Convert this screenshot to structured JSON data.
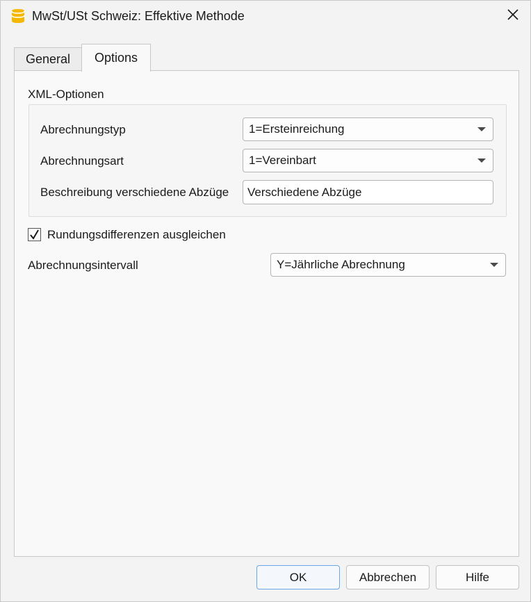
{
  "window": {
    "title": "MwSt/USt Schweiz: Effektive Methode"
  },
  "tabs": [
    {
      "label": "General",
      "active": false
    },
    {
      "label": "Options",
      "active": true
    }
  ],
  "options": {
    "xml_section_label": "XML-Optionen",
    "abrechnungstyp": {
      "label": "Abrechnungstyp",
      "value": "1=Ersteinreichung"
    },
    "abrechnungsart": {
      "label": "Abrechnungsart",
      "value": "1=Vereinbart"
    },
    "beschreibung": {
      "label": "Beschreibung verschiedene Abzüge",
      "value": "Verschiedene Abzüge"
    },
    "rundung": {
      "label": "Rundungsdifferenzen ausgleichen",
      "checked": true
    },
    "intervall": {
      "label": "Abrechnungsintervall",
      "value": "Y=Jährliche Abrechnung"
    }
  },
  "buttons": {
    "ok": "OK",
    "cancel": "Abbrechen",
    "help": "Hilfe"
  },
  "colors": {
    "app_icon": "#f5b800",
    "default_button_border": "#6aa6e8"
  },
  "icons": {
    "app": "database-icon",
    "close": "close-icon",
    "checkmark": "checkmark-icon",
    "dropdown": "chevron-down-icon"
  }
}
